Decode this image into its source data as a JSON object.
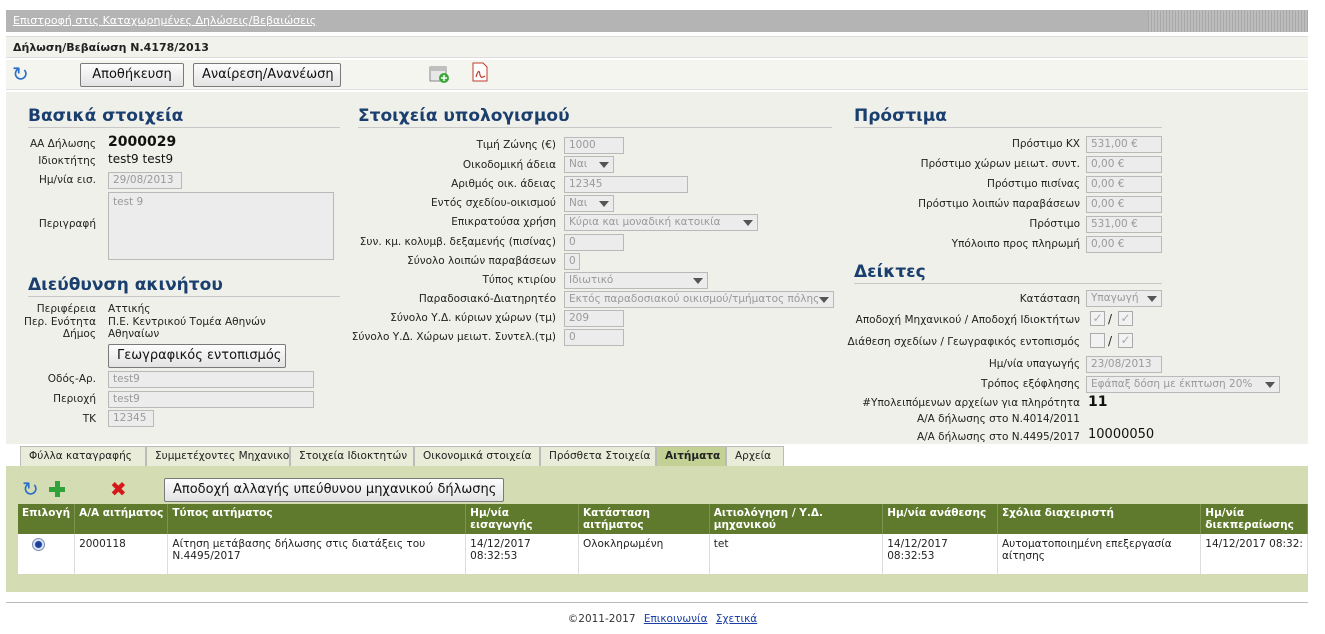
{
  "top": {
    "back_link": "Επιστροφή στις Καταχωρημένες Δηλώσεις/Βεβαιώσεις"
  },
  "header": {
    "title": "Δήλωση/Βεβαίωση Ν.4178/2013"
  },
  "toolbar": {
    "save_label": "Αποθήκευση",
    "reload_label": "Αναίρεση/Ανανέωση"
  },
  "basic": {
    "title": "Βασικά στοιχεία",
    "aa_label": "ΑΑ Δήλωσης",
    "aa_value": "2000029",
    "owner_label": "Ιδιοκτήτης",
    "owner_value": "test9 test9",
    "date_label": "Ημ/νία εισ.",
    "date_value": "29/08/2013",
    "desc_label": "Περιγραφή",
    "desc_value": "test 9"
  },
  "address": {
    "title": "Διεύθυνση ακινήτου",
    "region_label": "Περιφέρεια",
    "region_value": "Αττικής",
    "unit_label": "Περ. Ενότητα",
    "unit_value": "Π.Ε. Κεντρικού Τομέα Αθηνών",
    "municipality_label": "Δήμος",
    "municipality_value": "Αθηναίων",
    "geo_button": "Γεωγραφικός εντοπισμός",
    "street_label": "Οδός-Αρ.",
    "street_value": "test9",
    "area_label": "Περιοχή",
    "area_value": "test9",
    "tk_label": "ΤΚ",
    "tk_value": "12345"
  },
  "calc": {
    "title": "Στοιχεία υπολογισμού",
    "fields": [
      {
        "label": "Τιμή Ζώνης (€)",
        "value": "1000"
      },
      {
        "label": "Οικοδομική άδεια",
        "value": "Ναι"
      },
      {
        "label": "Αριθμός οικ. άδειας",
        "value": "12345"
      },
      {
        "label": "Εντός σχεδίου-οικισμού",
        "value": "Ναι"
      },
      {
        "label": "Επικρατούσα χρήση",
        "value": "Κύρια και μοναδική κατοικία"
      },
      {
        "label": "Συν. κμ. κολυμβ. δεξαμενής (πισίνας)",
        "value": "0"
      },
      {
        "label": "Σύνολο λοιπών παραβάσεων",
        "value": "0"
      },
      {
        "label": "Τύπος κτιρίου",
        "value": "Ιδιωτικό"
      },
      {
        "label": "Παραδοσιακό-Διατηρητέο",
        "value": "Εκτός παραδοσιακού οικισμού/τμήματος πόλης"
      },
      {
        "label": "Σύνολο Υ.Δ. κύριων χώρων (τμ)",
        "value": "209"
      },
      {
        "label": "Σύνολο Υ.Δ. Χώρων μειωτ. Συντελ.(τμ)",
        "value": "0"
      }
    ]
  },
  "fines": {
    "title": "Πρόστιμα",
    "fields": [
      {
        "label": "Πρόστιμο ΚΧ",
        "value": "531,00 €"
      },
      {
        "label": "Πρόστιμο χώρων μειωτ. συντ.",
        "value": "0,00 €"
      },
      {
        "label": "Πρόστιμο πισίνας",
        "value": "0,00 €"
      },
      {
        "label": "Πρόστιμο λοιπών παραβάσεων",
        "value": "0,00 €"
      },
      {
        "label": "Πρόστιμο",
        "value": "531,00 €"
      },
      {
        "label": "Υπόλοιπο προς πληρωμή",
        "value": "0,00 €"
      }
    ]
  },
  "indicators": {
    "title": "Δείκτες",
    "status_label": "Κατάσταση",
    "status_value": "Υπαγωγή",
    "accept_label": "Αποδοχή Μηχανικού / Αποδοχή Ιδιοκτήτων",
    "plans_label": "Διάθεση σχεδίων / Γεωγραφικός εντοπισμός",
    "subdate_label": "Ημ/νία υπαγωγής",
    "subdate_value": "23/08/2013",
    "payment_label": "Τρόπος εξόφλησης",
    "payment_value": "Εφάπαξ δόση με έκπτωση 20%",
    "remaining_label": "#Υπολειπόμενων αρχείων για πληρότητα",
    "remaining_value": "11",
    "aa4014_label": "Α/Α δήλωσης στο Ν.4014/2011",
    "aa4014_value": "",
    "aa4495_label": "Α/Α δήλωσης στο Ν.4495/2017",
    "aa4495_value": "10000050"
  },
  "tabs": [
    "Φύλλα καταγραφής",
    "Συμμετέχοντες Μηχανικοί",
    "Στοιχεία Ιδιοκτητών",
    "Οικονομικά στοιχεία",
    "Πρόσθετα Στοιχεία",
    "Αιτήματα",
    "Αρχεία"
  ],
  "requests": {
    "accept_change_button": "Αποδοχή αλλαγής υπεύθυνου μηχανικού δήλωσης",
    "columns": [
      "Επιλογή",
      "Α/Α αιτήματος",
      "Τύπος αιτήματος",
      "Ημ/νία εισαγωγής",
      "Κατάσταση αιτήματος",
      "Αιτιολόγηση / Υ.Δ. μηχανικού",
      "Ημ/νία ανάθεσης",
      "Σχόλια διαχειριστή",
      "Ημ/νία διεκπεραίωσης"
    ],
    "row": {
      "aa": "2000118",
      "type": "Αίτηση μετάβασης δήλωσης στις διατάξεις του Ν.4495/2017",
      "entry_date": "14/12/2017 08:32:53",
      "status": "Ολοκληρωμένη",
      "justification": "tet",
      "assign_date": "14/12/2017 08:32:53",
      "comments": "Αυτοματοποιημένη επεξεργασία αίτησης",
      "done_date": "14/12/2017 08:32:"
    }
  },
  "footer": {
    "copyright": "©2011-2017",
    "contact": "Επικοινωνία",
    "about": "Σχετικά"
  }
}
